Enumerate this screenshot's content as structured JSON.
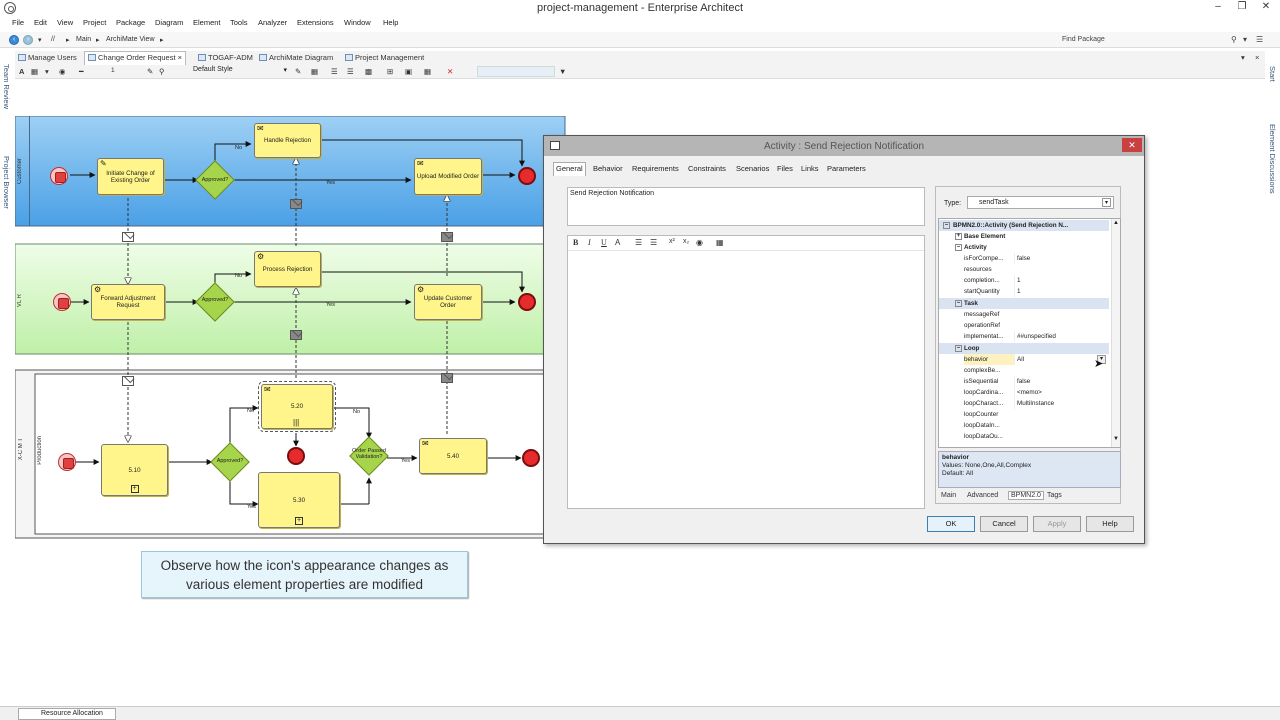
{
  "window": {
    "title": "project-management - Enterprise Architect"
  },
  "menu": [
    "File",
    "Edit",
    "View",
    "Project",
    "Package",
    "Diagram",
    "Element",
    "Tools",
    "Analyzer",
    "Extensions",
    "Window",
    "Help"
  ],
  "nav": {
    "path_sep": "//",
    "crumb1": "Main",
    "crumb2": "ArchiMate View",
    "find": "Find Package"
  },
  "tabs": [
    {
      "label": "Manage Users"
    },
    {
      "label": "Change Order Request",
      "active": true
    },
    {
      "label": "TOGAF-ADM"
    },
    {
      "label": "ArchiMate Diagram"
    },
    {
      "label": "Project Management"
    }
  ],
  "formatbar": {
    "font_size": "1",
    "style": "Default Style"
  },
  "side_left": [
    "Team Review",
    "Project Browser"
  ],
  "side_right": [
    "Start",
    "Element Discussions"
  ],
  "diagram": {
    "lanes": {
      "customer": "Customer",
      "vlr": "VL R",
      "production": "Production",
      "xcmt": "X-C M T"
    },
    "tasks": {
      "t1": "Initiate Change of Existing Order",
      "t2": "Handle Rejection",
      "t3": "Upload Modified Order",
      "t4": "Forward Adjustment Request",
      "t5": "Process Rejection",
      "t6": "Update Customer Order",
      "t7": "5.20",
      "t8": "5.10",
      "t9": "5.30",
      "t10": "5.40"
    },
    "gateways": {
      "g1": "Approved?",
      "g2": "Approved?",
      "g3": "Approved?",
      "g4": "Order Passed Validation?"
    },
    "edge_labels": {
      "no": "No",
      "yes": "Yes"
    }
  },
  "note": {
    "line1": "Observe how the icon's appearance changes as",
    "line2": "various element properties are modified"
  },
  "dialog": {
    "title": "Activity : Send Rejection Notification",
    "tabs": [
      "General",
      "Behavior",
      "Requirements",
      "Constraints",
      "Scenarios",
      "Files",
      "Links",
      "Parameters"
    ],
    "name": "Send Rejection Notification",
    "type_label": "Type:",
    "type_value": "sendTask",
    "grid_header": "BPMN2.0::Activity (Send Rejection N...",
    "cat_base": "Base Element",
    "cat_activity": "Activity",
    "cat_task": "Task",
    "cat_loop": "Loop",
    "rows": [
      {
        "k": "isForCompe...",
        "v": "false"
      },
      {
        "k": "resources",
        "v": ""
      },
      {
        "k": "completion...",
        "v": "1"
      },
      {
        "k": "startQuantity",
        "v": "1"
      },
      {
        "k": "messageRef",
        "v": ""
      },
      {
        "k": "operationRef",
        "v": ""
      },
      {
        "k": "implementat...",
        "v": "##unspecified"
      },
      {
        "k": "behavior",
        "v": "All"
      },
      {
        "k": "complexBe...",
        "v": ""
      },
      {
        "k": "isSequential",
        "v": "false"
      },
      {
        "k": "loopCardina...",
        "v": "<memo>"
      },
      {
        "k": "loopCharact...",
        "v": "MultiInstance"
      },
      {
        "k": "loopCounter",
        "v": ""
      },
      {
        "k": "loopDataIn...",
        "v": ""
      },
      {
        "k": "loopDataOu...",
        "v": ""
      }
    ],
    "help_title": "behavior",
    "help_values": "Values: None,One,All,Complex",
    "help_default": "Default: All",
    "prop_tabs": [
      "Main",
      "Advanced",
      "BPMN2.0",
      "Tags"
    ],
    "buttons": {
      "ok": "OK",
      "cancel": "Cancel",
      "apply": "Apply",
      "help": "Help"
    }
  },
  "status": {
    "tab": "Resource Allocation"
  }
}
